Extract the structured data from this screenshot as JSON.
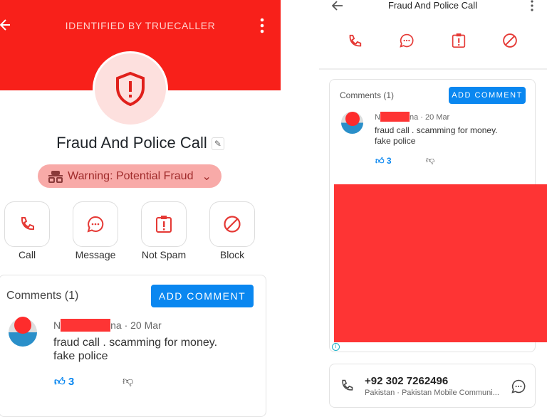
{
  "left": {
    "header_title": "IDENTIFIED BY TRUECALLER",
    "contact_name": "Fraud And Police Call",
    "warning": "Warning: Potential Fraud",
    "actions": [
      {
        "label": "Call",
        "icon": "phone-icon"
      },
      {
        "label": "Message",
        "icon": "message-icon"
      },
      {
        "label": "Not Spam",
        "icon": "clipboard-alert-icon"
      },
      {
        "label": "Block",
        "icon": "block-icon"
      }
    ],
    "comments": {
      "title": "Comments (1)",
      "add_label": "ADD COMMENT",
      "author_start": "N",
      "author_end": "na",
      "date": "· 20 Mar",
      "text_line1": "fraud call . scamming for money.",
      "text_line2": "fake police",
      "likes": "3"
    }
  },
  "right": {
    "header_title": "Fraud And Police Call",
    "comments": {
      "title": "Comments (1)",
      "add_label": "ADD COMMENT",
      "author_start": "N",
      "author_end": "na",
      "date": "· 20 Mar",
      "text_line1": "fraud call . scamming for money.",
      "text_line2": "fake police",
      "likes": "3"
    },
    "phone": {
      "number": "+92 302 7262496",
      "details": "Pakistan · Pakistan Mobile Communi..."
    }
  },
  "colors": {
    "brand_red": "#f8201a",
    "accent_blue": "#0a87f0",
    "icon_red": "#e53935"
  }
}
